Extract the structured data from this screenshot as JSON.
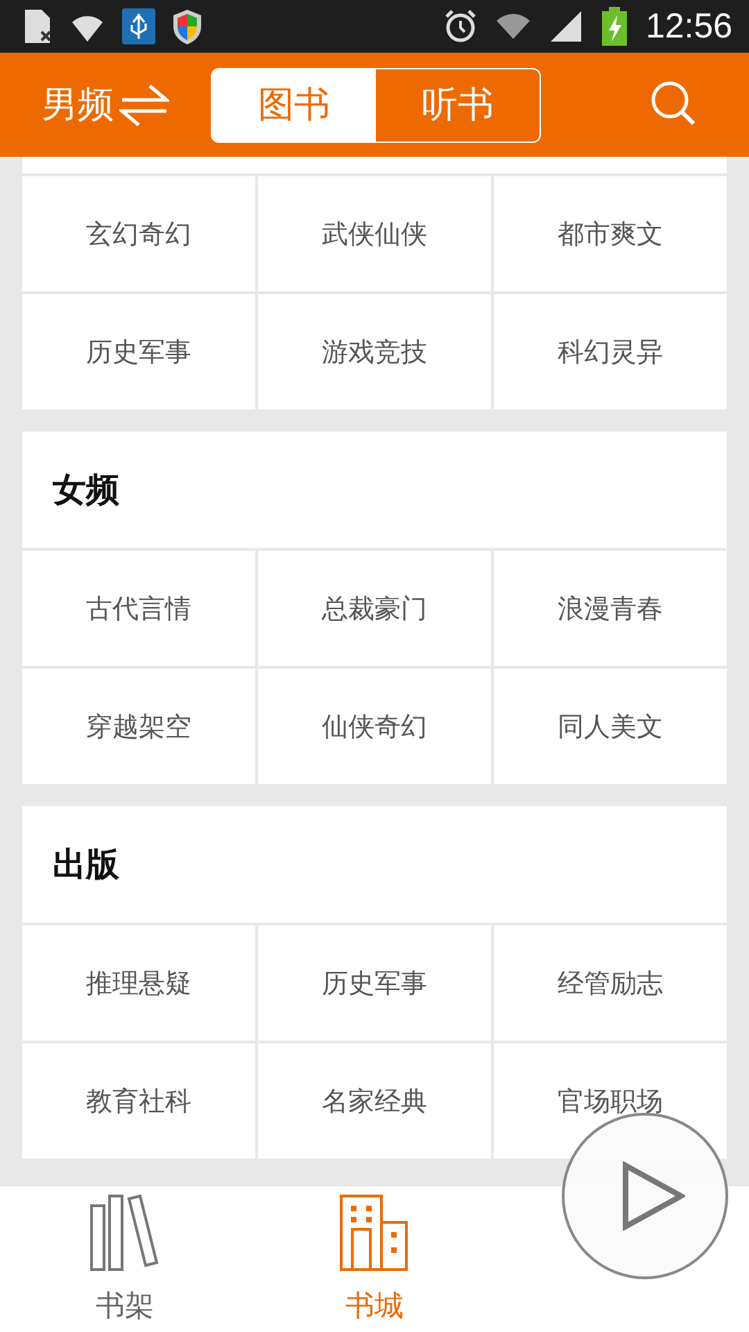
{
  "status_bar": {
    "time": "12:56"
  },
  "header": {
    "channel": "男频",
    "tabs": [
      {
        "label": "图书",
        "selected": true
      },
      {
        "label": "听书",
        "selected": false
      }
    ]
  },
  "sections": [
    {
      "genres": [
        "玄幻奇幻",
        "武侠仙侠",
        "都市爽文",
        "历史军事",
        "游戏竞技",
        "科幻灵异"
      ]
    },
    {
      "title": "女频",
      "genres": [
        "古代言情",
        "总裁豪门",
        "浪漫青春",
        "穿越架空",
        "仙侠奇幻",
        "同人美文"
      ]
    },
    {
      "title": "出版",
      "genres": [
        "推理悬疑",
        "历史军事",
        "经管励志",
        "教育社科",
        "名家经典",
        "官场职场"
      ]
    }
  ],
  "bottom_nav": [
    {
      "label": "书架",
      "kind": "shelf",
      "selected": false
    },
    {
      "label": "书城",
      "kind": "store",
      "selected": true
    }
  ]
}
